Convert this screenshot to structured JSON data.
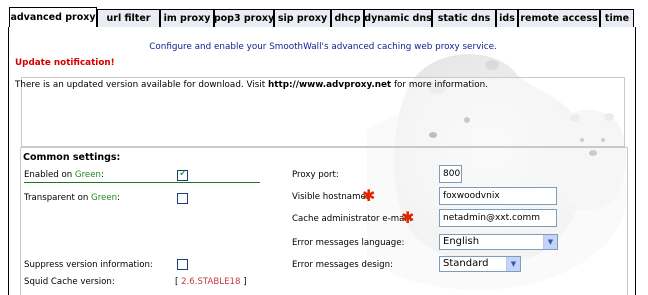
{
  "tabs": [
    {
      "label": "advanced proxy",
      "active": true
    },
    {
      "label": "url filter",
      "active": false
    },
    {
      "label": "im proxy",
      "active": false
    },
    {
      "label": "pop3 proxy",
      "active": false
    },
    {
      "label": "sip proxy",
      "active": false
    },
    {
      "label": "dhcp",
      "active": false
    },
    {
      "label": "dynamic dns",
      "active": false
    },
    {
      "label": "static dns",
      "active": false
    },
    {
      "label": "ids",
      "active": false
    },
    {
      "label": "remote access",
      "active": false
    },
    {
      "label": "time",
      "active": false
    }
  ],
  "intro": "Configure and enable your SmoothWall's advanced caching web proxy service.",
  "notification": {
    "title": "Update notification!",
    "text_before": "There is an updated version available for download. Visit ",
    "url": "http://www.advproxy.net",
    "text_after": " for more information."
  },
  "common": {
    "title": "Common settings:",
    "enabled_label_prefix": "Enabled on ",
    "enabled_label_zone": "Green",
    "enabled_label_suffix": ":",
    "enabled_checked": true,
    "transparent_label_prefix": "Transparent on ",
    "transparent_label_zone": "Green",
    "transparent_label_suffix": ":",
    "transparent_checked": false,
    "suppress_label": "Suppress version information:",
    "suppress_checked": false,
    "squid_label": "Squid Cache version:",
    "squid_open": "[ ",
    "squid_version": "2.6.STABLE18",
    "squid_close": " ]",
    "port_label": "Proxy port:",
    "port_value": "800",
    "hostname_label": "Visible hostname:",
    "hostname_value": "foxwoodvnix",
    "email_label": "Cache administrator e-mail:",
    "email_value": "netadmin@xxt.comm",
    "errlang_label": "Error messages language:",
    "errlang_value": "English",
    "errdesign_label": "Error messages design:",
    "errdesign_value": "Standard"
  },
  "colors": {
    "intro_blue": "#0b1f8f",
    "notice_red": "#d40000",
    "green": "#1f8a1f",
    "required_star": "#e32400"
  }
}
